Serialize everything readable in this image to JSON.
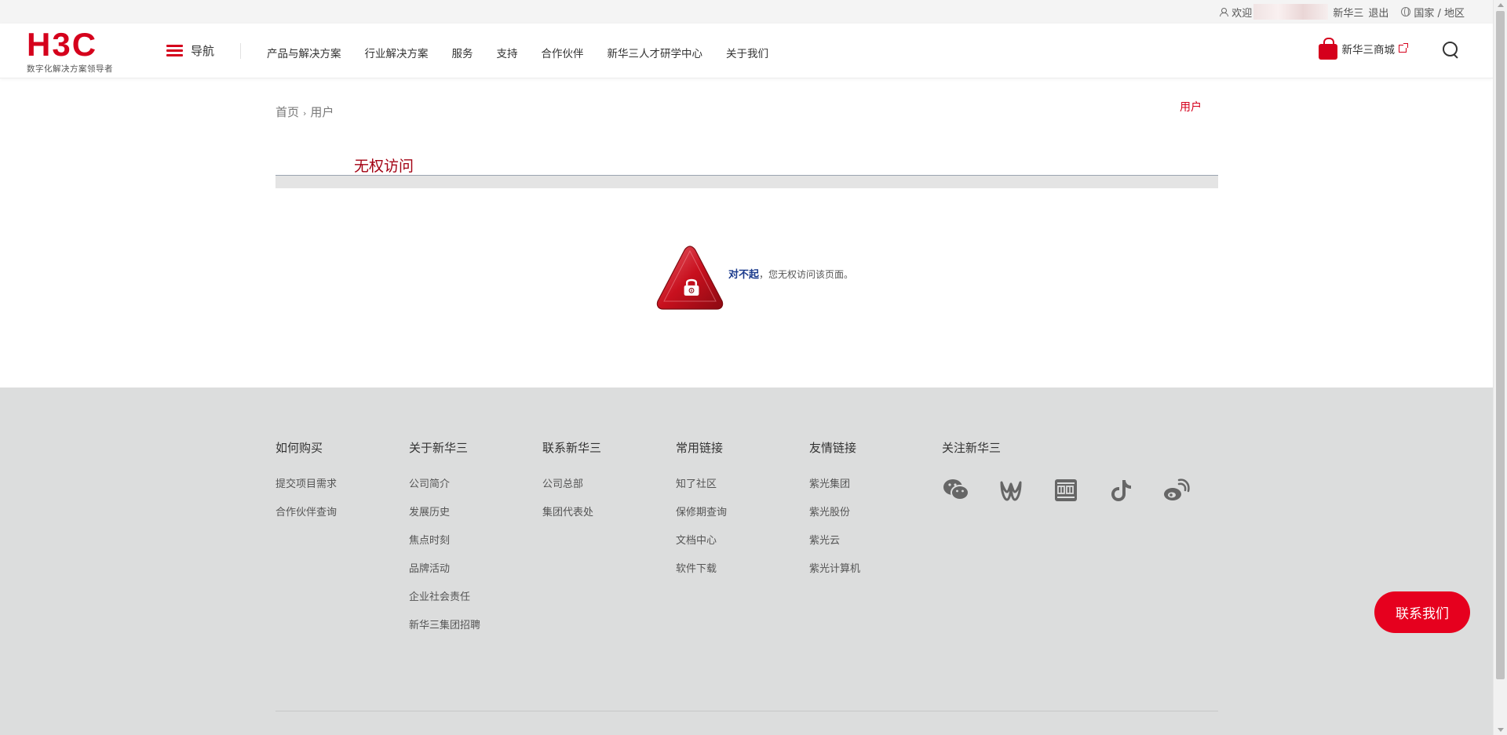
{
  "topbar": {
    "welcome": "欢迎",
    "company": "新华三",
    "logout": "退出",
    "region": "国家 / 地区"
  },
  "header": {
    "logo_text": "H3C",
    "logo_tagline": "数字化解决方案领导者",
    "nav_label": "导航",
    "nav_items": [
      "产品与解决方案",
      "行业解决方案",
      "服务",
      "支持",
      "合作伙伴",
      "新华三人才研学中心",
      "关于我们"
    ],
    "shop_label": "新华三商城"
  },
  "breadcrumb": {
    "home": "首页",
    "current": "用户"
  },
  "side_link": "用户",
  "page_title": "无权访问",
  "message": {
    "emphasis": "对不起",
    "text": "，您无权访问该页面。"
  },
  "footer": {
    "columns": [
      {
        "title": "如何购买",
        "links": [
          "提交项目需求",
          "合作伙伴查询"
        ]
      },
      {
        "title": "关于新华三",
        "links": [
          "公司简介",
          "发展历史",
          "焦点时刻",
          "品牌活动",
          "企业社会责任",
          "新华三集团招聘"
        ]
      },
      {
        "title": "联系新华三",
        "links": [
          "公司总部",
          "集团代表处"
        ]
      },
      {
        "title": "常用链接",
        "links": [
          "知了社区",
          "保修期查询",
          "文档中心",
          "软件下载"
        ]
      },
      {
        "title": "友情链接",
        "links": [
          "紫光集团",
          "紫光股份",
          "紫光云",
          "紫光计算机"
        ]
      },
      {
        "title": "关注新华三",
        "links": []
      }
    ],
    "social_icons": [
      "wechat-icon",
      "weishi-icon",
      "toutiao-icon",
      "douyin-icon",
      "weibo-icon"
    ]
  },
  "contact_button": "联系我们",
  "colors": {
    "brand_red": "#d5001c",
    "footer_bg": "#dcdddd",
    "title_red": "#a30012"
  }
}
